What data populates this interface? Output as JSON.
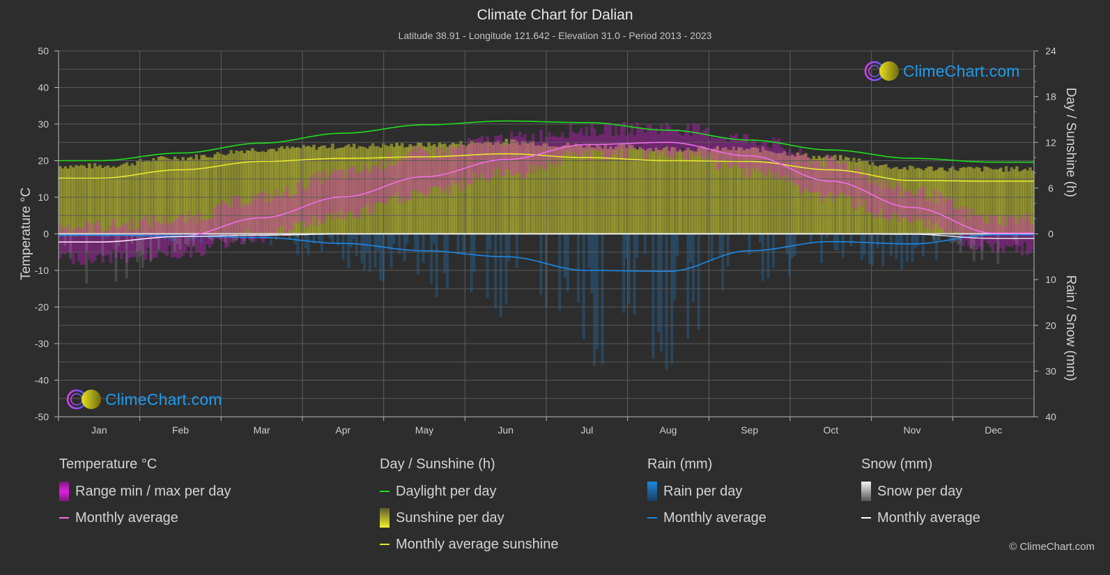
{
  "header": {
    "title": "Climate Chart for Dalian",
    "subtitle": "Latitude 38.91 - Longitude 121.642 - Elevation 31.0 - Period 2013 - 2023"
  },
  "logo": {
    "text": "ClimeChart.com"
  },
  "copyright": "© ClimeChart.com",
  "legend": {
    "temperature": {
      "title": "Temperature °C",
      "items": [
        "Range min / max per day",
        "Monthly average"
      ]
    },
    "sunshine": {
      "title": "Day / Sunshine (h)",
      "items": [
        "Daylight per day",
        "Sunshine per day",
        "Monthly average sunshine"
      ]
    },
    "rain": {
      "title": "Rain (mm)",
      "items": [
        "Rain per day",
        "Monthly average"
      ]
    },
    "snow": {
      "title": "Snow (mm)",
      "items": [
        "Snow per day",
        "Monthly average"
      ]
    }
  },
  "colors": {
    "background": "#2d2d2d",
    "temp_range": "#e020e0",
    "temp_avg": "#f06ee8",
    "daylight": "#22dd22",
    "sunshine_bar": "#c8c832",
    "sunshine_avg": "#e8e830",
    "rain_bar": "#1e82d2",
    "rain_avg": "#1e88e5",
    "snow_bar": "#bbbbbb",
    "snow_avg": "#ffffff"
  },
  "chart_data": {
    "type": "line",
    "title": "Climate Chart for Dalian",
    "categories": [
      "Jan",
      "Feb",
      "Mar",
      "Apr",
      "May",
      "Jun",
      "Jul",
      "Aug",
      "Sep",
      "Oct",
      "Nov",
      "Dec"
    ],
    "axes": {
      "left": {
        "label": "Temperature °C",
        "range": [
          -50,
          50
        ],
        "ticks": [
          "50",
          "40",
          "30",
          "20",
          "10",
          "0",
          "-10",
          "-20",
          "-30",
          "-40",
          "-50"
        ]
      },
      "right_top": {
        "label": "Day / Sunshine (h)",
        "range": [
          0,
          24
        ],
        "ticks": [
          "24",
          "18",
          "12",
          "6",
          "0"
        ]
      },
      "right_bottom": {
        "label": "Rain / Snow (mm)",
        "range": [
          0,
          40
        ],
        "ticks": [
          "10",
          "20",
          "30",
          "40"
        ]
      }
    },
    "grid": true,
    "series": [
      {
        "name": "Temperature monthly average",
        "axis": "left",
        "values": [
          -2.2,
          -0.7,
          4.4,
          10.1,
          15.6,
          20.3,
          24.4,
          25.0,
          21.3,
          14.4,
          7.2,
          0.2
        ]
      },
      {
        "name": "Temperature daily max (approx)",
        "axis": "left",
        "values": [
          2.0,
          4.0,
          10.0,
          16.5,
          22.0,
          26.0,
          28.5,
          29.0,
          26.0,
          19.5,
          11.5,
          4.0
        ]
      },
      {
        "name": "Temperature daily min (approx)",
        "axis": "left",
        "values": [
          -6.5,
          -5.0,
          -0.5,
          5.0,
          11.0,
          16.5,
          21.5,
          22.0,
          17.5,
          10.0,
          3.0,
          -4.0
        ]
      },
      {
        "name": "Daylight per day",
        "axis": "right_top",
        "values": [
          9.6,
          10.6,
          11.9,
          13.2,
          14.3,
          14.8,
          14.6,
          13.6,
          12.3,
          11.0,
          9.9,
          9.4
        ]
      },
      {
        "name": "Monthly average sunshine",
        "axis": "right_top",
        "values": [
          7.3,
          8.4,
          9.5,
          9.9,
          10.1,
          10.5,
          10.0,
          9.6,
          9.5,
          8.4,
          7.0,
          6.9
        ]
      },
      {
        "name": "Rain monthly average",
        "axis": "right_bottom",
        "values": [
          0.3,
          0.5,
          0.8,
          2.1,
          3.7,
          5.0,
          8.0,
          8.2,
          3.7,
          1.7,
          2.2,
          0.2
        ]
      },
      {
        "name": "Snow monthly average",
        "axis": "right_bottom",
        "values": [
          1.8,
          0.6,
          0.3,
          0.05,
          0,
          0,
          0,
          0,
          0,
          0,
          0.1,
          1.0
        ]
      }
    ]
  }
}
